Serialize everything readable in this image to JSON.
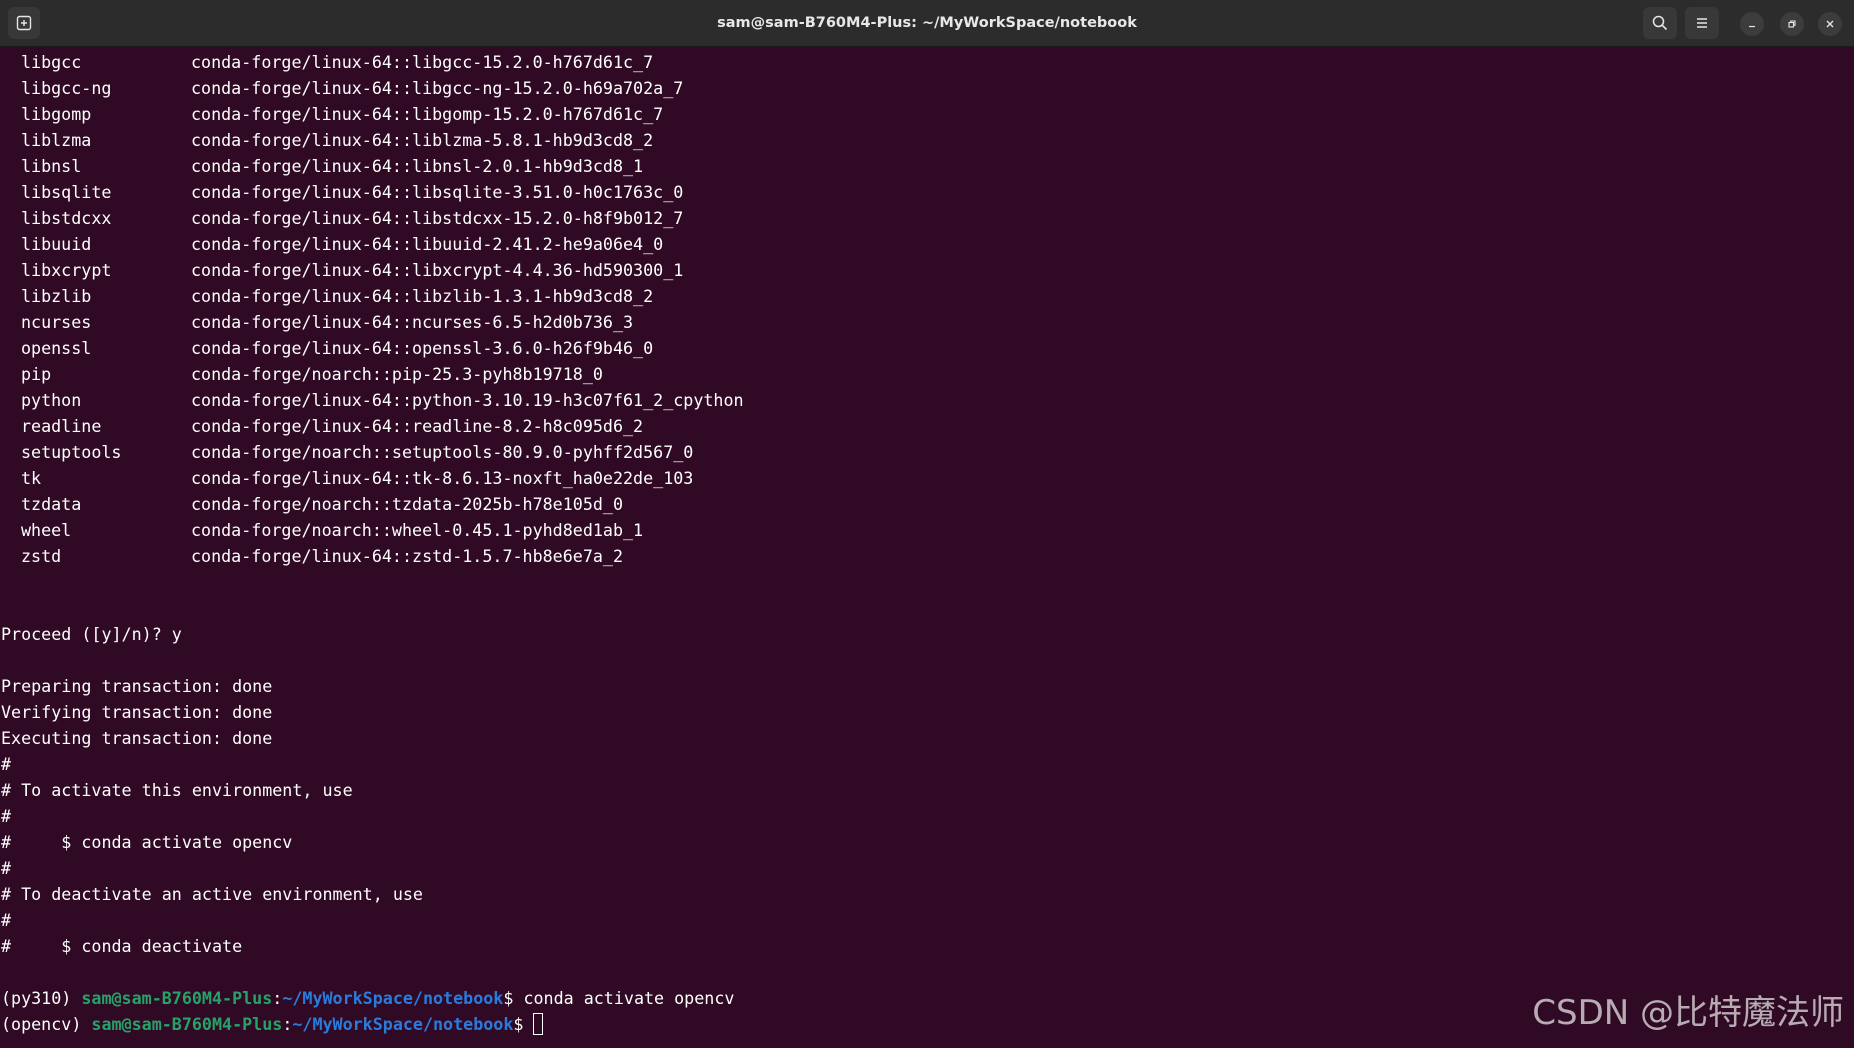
{
  "window": {
    "title": "sam@sam-B760M4-Plus: ~/MyWorkSpace/notebook"
  },
  "terminal": {
    "packages": [
      {
        "name": "libgcc",
        "spec": "conda-forge/linux-64::libgcc-15.2.0-h767d61c_7"
      },
      {
        "name": "libgcc-ng",
        "spec": "conda-forge/linux-64::libgcc-ng-15.2.0-h69a702a_7"
      },
      {
        "name": "libgomp",
        "spec": "conda-forge/linux-64::libgomp-15.2.0-h767d61c_7"
      },
      {
        "name": "liblzma",
        "spec": "conda-forge/linux-64::liblzma-5.8.1-hb9d3cd8_2"
      },
      {
        "name": "libnsl",
        "spec": "conda-forge/linux-64::libnsl-2.0.1-hb9d3cd8_1"
      },
      {
        "name": "libsqlite",
        "spec": "conda-forge/linux-64::libsqlite-3.51.0-h0c1763c_0"
      },
      {
        "name": "libstdcxx",
        "spec": "conda-forge/linux-64::libstdcxx-15.2.0-h8f9b012_7"
      },
      {
        "name": "libuuid",
        "spec": "conda-forge/linux-64::libuuid-2.41.2-he9a06e4_0"
      },
      {
        "name": "libxcrypt",
        "spec": "conda-forge/linux-64::libxcrypt-4.4.36-hd590300_1"
      },
      {
        "name": "libzlib",
        "spec": "conda-forge/linux-64::libzlib-1.3.1-hb9d3cd8_2"
      },
      {
        "name": "ncurses",
        "spec": "conda-forge/linux-64::ncurses-6.5-h2d0b736_3"
      },
      {
        "name": "openssl",
        "spec": "conda-forge/linux-64::openssl-3.6.0-h26f9b46_0"
      },
      {
        "name": "pip",
        "spec": "conda-forge/noarch::pip-25.3-pyh8b19718_0"
      },
      {
        "name": "python",
        "spec": "conda-forge/linux-64::python-3.10.19-h3c07f61_2_cpython"
      },
      {
        "name": "readline",
        "spec": "conda-forge/linux-64::readline-8.2-h8c095d6_2"
      },
      {
        "name": "setuptools",
        "spec": "conda-forge/noarch::setuptools-80.9.0-pyhff2d567_0"
      },
      {
        "name": "tk",
        "spec": "conda-forge/linux-64::tk-8.6.13-noxft_ha0e22de_103"
      },
      {
        "name": "tzdata",
        "spec": "conda-forge/noarch::tzdata-2025b-h78e105d_0"
      },
      {
        "name": "wheel",
        "spec": "conda-forge/noarch::wheel-0.45.1-pyhd8ed1ab_1"
      },
      {
        "name": "zstd",
        "spec": "conda-forge/linux-64::zstd-1.5.7-hb8e6e7a_2"
      }
    ],
    "proceed": "Proceed ([y]/n)? y",
    "transaction": [
      "Preparing transaction: done",
      "Verifying transaction: done",
      "Executing transaction: done"
    ],
    "notes": [
      "#",
      "# To activate this environment, use",
      "#",
      "#     $ conda activate opencv",
      "#",
      "# To deactivate an active environment, use",
      "#",
      "#     $ conda deactivate"
    ],
    "prompt1": {
      "env": "(py310) ",
      "user_host": "sam@sam-B760M4-Plus",
      "sep": ":",
      "path": "~/MyWorkSpace/notebook",
      "dollar": "$ ",
      "command": "conda activate opencv"
    },
    "prompt2": {
      "env": "(opencv) ",
      "user_host": "sam@sam-B760M4-Plus",
      "sep": ":",
      "path": "~/MyWorkSpace/notebook",
      "dollar": "$ "
    }
  },
  "watermark": "CSDN @比特魔法师",
  "icons": {
    "new_tab": "new-tab-icon",
    "search": "search-icon",
    "menu": "hamburger-menu-icon",
    "minimize": "minimize-icon",
    "restore": "restore-icon",
    "close": "close-icon"
  },
  "colors": {
    "background": "#300a24",
    "titlebar": "#2c2c2c",
    "user_host": "#26a269",
    "path": "#2a7bde"
  }
}
